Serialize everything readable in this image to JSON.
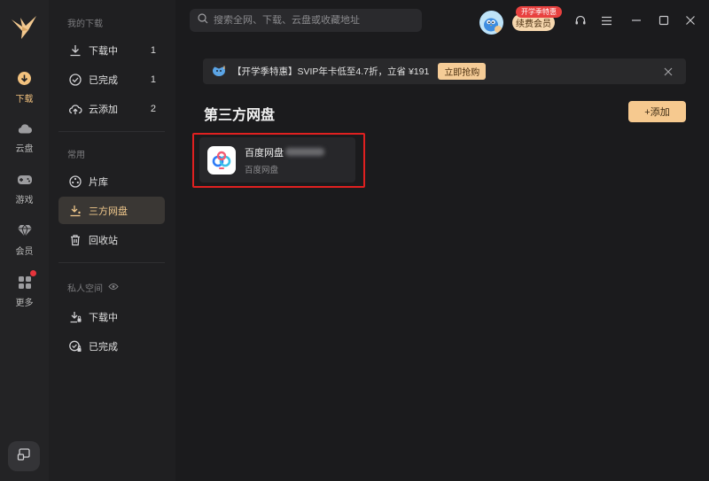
{
  "rail": {
    "items": [
      {
        "label": "下载",
        "icon": "download-icon",
        "active": true
      },
      {
        "label": "云盘",
        "icon": "cloud-icon"
      },
      {
        "label": "游戏",
        "icon": "gamepad-icon"
      },
      {
        "label": "会员",
        "icon": "diamond-icon"
      },
      {
        "label": "更多",
        "icon": "grid-icon",
        "badge": true
      }
    ]
  },
  "sidebar": {
    "my_downloads_header": "我的下载",
    "downloads": [
      {
        "label": "下载中",
        "count": "1",
        "icon": "download-arrow-icon"
      },
      {
        "label": "已完成",
        "count": "1",
        "icon": "check-circle-icon"
      },
      {
        "label": "云添加",
        "count": "2",
        "icon": "cloud-upload-icon"
      }
    ],
    "common_header": "常用",
    "common": [
      {
        "label": "片库",
        "icon": "film-reel-icon"
      },
      {
        "label": "三方网盘",
        "icon": "download-tray-icon",
        "active": true
      },
      {
        "label": "回收站",
        "icon": "trash-icon"
      }
    ],
    "private_header": "私人空间",
    "private": [
      {
        "label": "下载中",
        "icon": "lock-download-icon"
      },
      {
        "label": "已完成",
        "icon": "lock-check-icon"
      }
    ]
  },
  "header": {
    "search_placeholder": "搜索全网、下载、云盘或收藏地址",
    "promo_badge": "开学季特惠",
    "renew_label": "续费会员"
  },
  "banner": {
    "text": "【开学季特惠】SVIP年卡低至4.7折，立省 ¥191",
    "button": "立即抢购"
  },
  "main": {
    "title": "第三方网盘",
    "add_button": "+添加",
    "drives": [
      {
        "name": "百度网盘",
        "subtitle": "百度网盘"
      }
    ]
  },
  "colors": {
    "accent": "#f6c98f",
    "active_text": "#f0c88c",
    "highlight_border": "#e02020",
    "badge_red": "#e8413f"
  }
}
